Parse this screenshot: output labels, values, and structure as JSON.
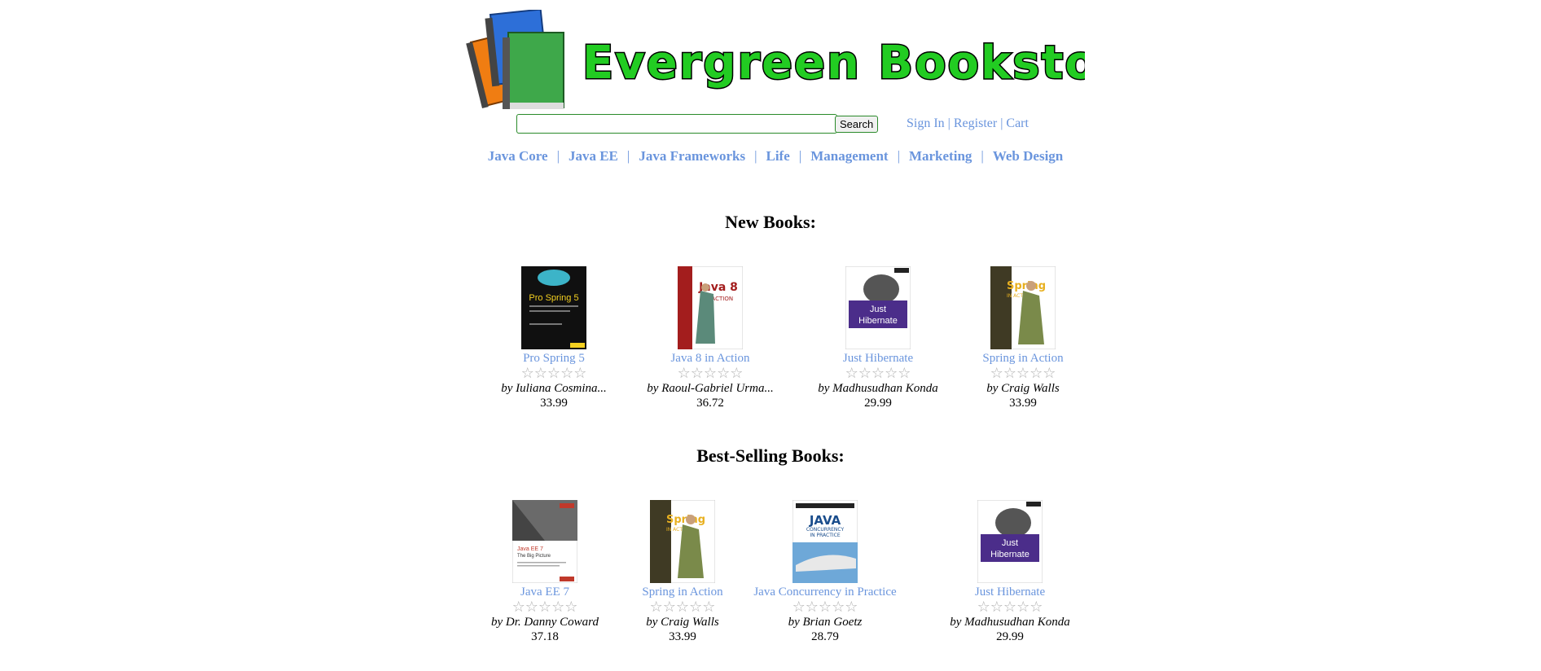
{
  "logo": {
    "text": "Evergreen Bookstore"
  },
  "search": {
    "value": "",
    "placeholder": "",
    "button_label": "Search"
  },
  "account": {
    "sign_in": "Sign In",
    "register": "Register",
    "cart": "Cart",
    "separator": "|"
  },
  "categories": [
    {
      "label": "Java Core"
    },
    {
      "label": "Java EE"
    },
    {
      "label": "Java Frameworks"
    },
    {
      "label": "Life"
    },
    {
      "label": "Management"
    },
    {
      "label": "Marketing"
    },
    {
      "label": "Web Design"
    }
  ],
  "nav_separator": "|",
  "new_books": {
    "heading": "New Books:",
    "items": [
      {
        "title": "Pro Spring 5",
        "author": "by Iuliana Cosmina...",
        "price": "33.99",
        "cover_text": "Pro Spring 5",
        "cover_color": "#101010",
        "rating": 0
      },
      {
        "title": "Java 8 in Action",
        "author": "by Raoul-Gabriel Urma...",
        "price": "36.72",
        "cover_text": "Java 8 IN ACTION",
        "cover_color": "#a31d1d",
        "rating": 0
      },
      {
        "title": "Just Hibernate",
        "author": "by Madhusudhan Konda",
        "price": "29.99",
        "cover_text": "Just Hibernate",
        "cover_color": "#4b2d8a",
        "rating": 0
      },
      {
        "title": "Spring in Action",
        "author": "by Craig Walls",
        "price": "33.99",
        "cover_text": "Spring IN ACTION",
        "cover_color": "#3f3a24",
        "rating": 0
      }
    ]
  },
  "best_selling": {
    "heading": "Best-Selling Books:",
    "items": [
      {
        "title": "Java EE 7",
        "author": "by Dr. Danny Coward",
        "price": "37.18",
        "cover_text": "Java EE 7 The Big Picture",
        "cover_color": "#6a6a6a",
        "rating": 0
      },
      {
        "title": "Spring in Action",
        "author": "by Craig Walls",
        "price": "33.99",
        "cover_text": "Spring IN ACTION",
        "cover_color": "#3f3a24",
        "rating": 0
      },
      {
        "title": "Java Concurrency in Practice",
        "author": "by Brian Goetz",
        "price": "28.79",
        "cover_text": "JAVA CONCURRENCY IN PRACTICE",
        "cover_color": "#1a4d8c",
        "rating": 0
      },
      {
        "title": "Just Hibernate",
        "author": "by Madhusudhan Konda",
        "price": "29.99",
        "cover_text": "Just Hibernate",
        "cover_color": "#4b2d8a",
        "rating": 0
      }
    ]
  },
  "colors": {
    "link": "#6a95dd",
    "logo_green": "#22cc22",
    "star_empty": "#b0b0b0"
  },
  "icons": {
    "star": "empty-star-icon"
  }
}
